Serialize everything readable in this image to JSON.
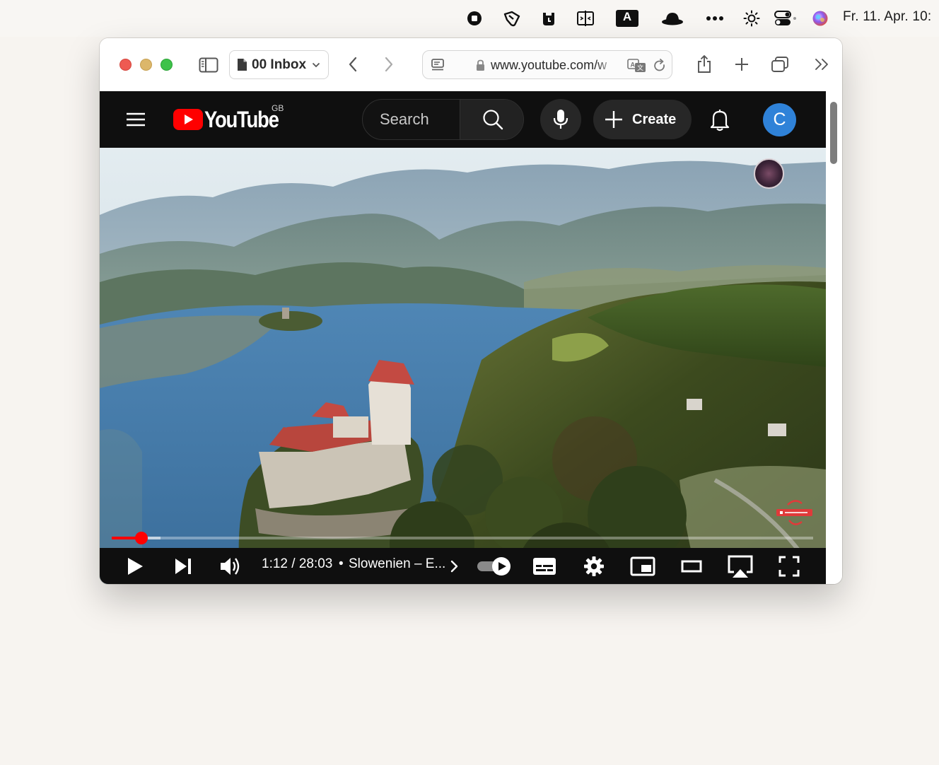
{
  "menubar": {
    "icons": [
      "record-icon",
      "cursor-pointer-icon",
      "timer-cup-icon",
      "split-screen-icon",
      "text-a-icon",
      "hat-icon",
      "more-dots-icon",
      "brightness-icon",
      "control-center-icon",
      "siri-icon"
    ],
    "icon_a_label": "A",
    "clock": "Fr. 11. Apr. 10:"
  },
  "browser": {
    "tab_group_label": "00 Inbox",
    "url": "www.youtube.com/w"
  },
  "youtube": {
    "logo_text": "YouTube",
    "region": "GB",
    "search_placeholder": "Search",
    "create_label": "Create",
    "avatar_letter": "C",
    "brand_color": "#ff0000"
  },
  "player": {
    "current_time": "1:12",
    "duration": "28:03",
    "time_display": "1:12 / 28:03",
    "separator": "•",
    "chapter_title": "Slowenien – E...",
    "progress_fraction": 0.0428,
    "buffered_fraction": 0.07,
    "autoplay_on": true
  }
}
